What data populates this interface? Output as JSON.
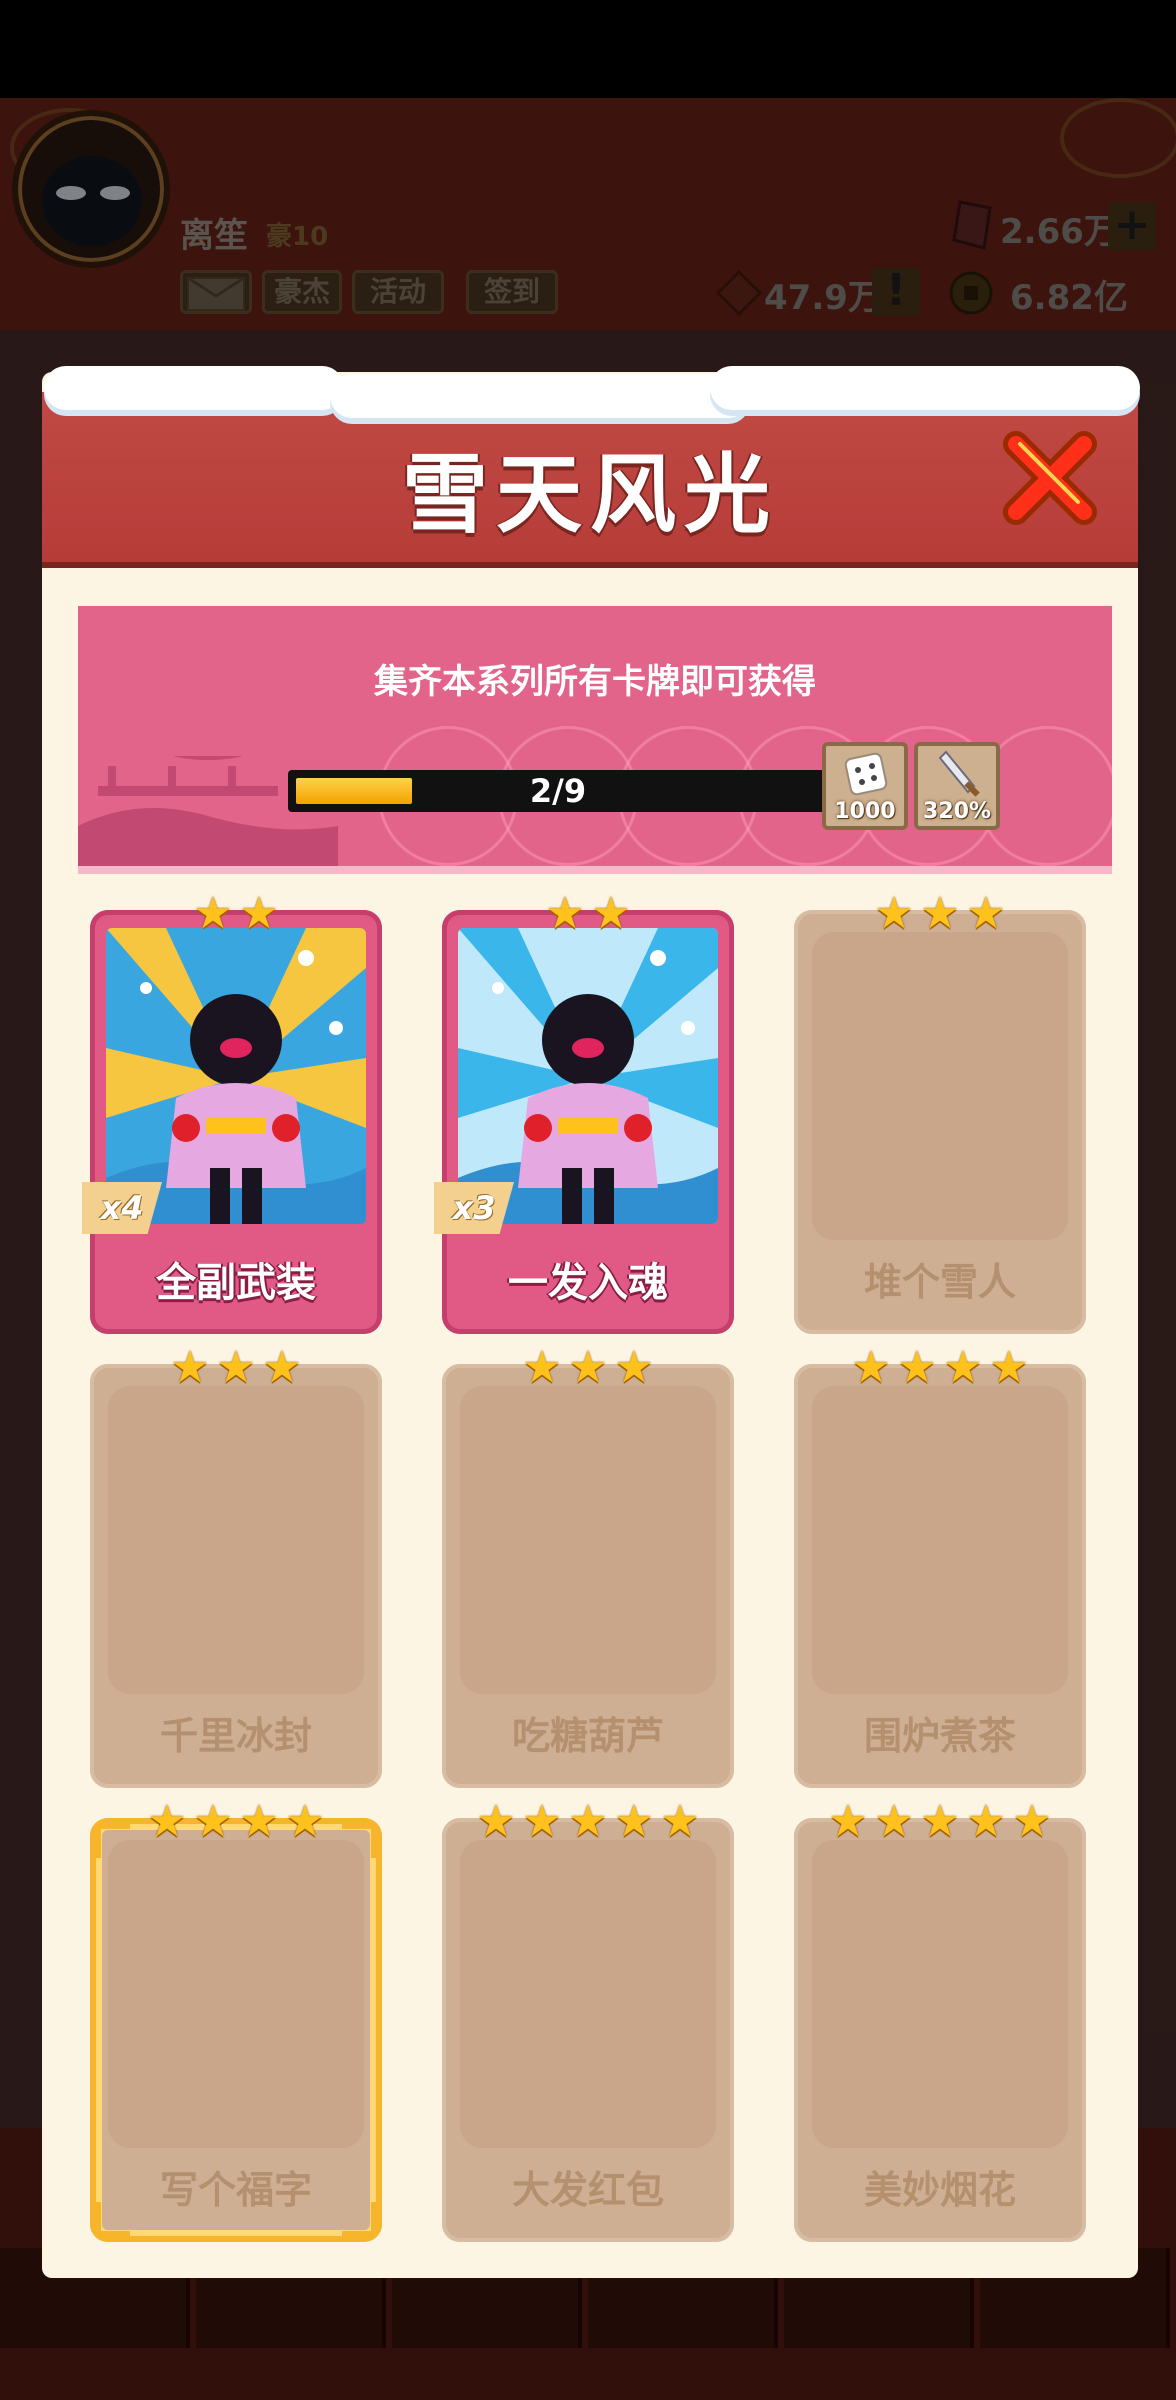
{
  "hud": {
    "player_name": "离笙",
    "player_rank": "豪10",
    "buttons": [
      "豪杰",
      "活动",
      "签到"
    ],
    "gems": "2.66万",
    "voucher": "47.9万",
    "coins": "6.82亿",
    "plus_label": "+",
    "alert_label": "!"
  },
  "modal": {
    "title": "雪天风光",
    "banner_text": "集齐本系列所有卡牌即可获得",
    "progress_text": "2/9",
    "progress_fraction": 0.222,
    "rewards": [
      {
        "icon": "dice-icon",
        "label": "1000"
      },
      {
        "icon": "sword-icon",
        "label": "320%"
      }
    ]
  },
  "cards": [
    {
      "name": "全副武装",
      "stars": 2,
      "owned": true,
      "count": "x4"
    },
    {
      "name": "一发入魂",
      "stars": 2,
      "owned": true,
      "count": "x3"
    },
    {
      "name": "堆个雪人",
      "stars": 3,
      "owned": false
    },
    {
      "name": "千里冰封",
      "stars": 3,
      "owned": false
    },
    {
      "name": "吃糖葫芦",
      "stars": 3,
      "owned": false
    },
    {
      "name": "围炉煮茶",
      "stars": 4,
      "owned": false
    },
    {
      "name": "写个福字",
      "stars": 4,
      "owned": false,
      "gold": true
    },
    {
      "name": "大发红包",
      "stars": 5,
      "owned": false
    },
    {
      "name": "美妙烟花",
      "stars": 5,
      "owned": false
    }
  ],
  "colors": {
    "header_red": "#c14a45",
    "banner_pink": "#e3648a",
    "card_pink": "#e15a86",
    "locked_tan": "#cfaf94",
    "star_gold": "#ffc21c",
    "progress_yellow": "#f3a300"
  }
}
